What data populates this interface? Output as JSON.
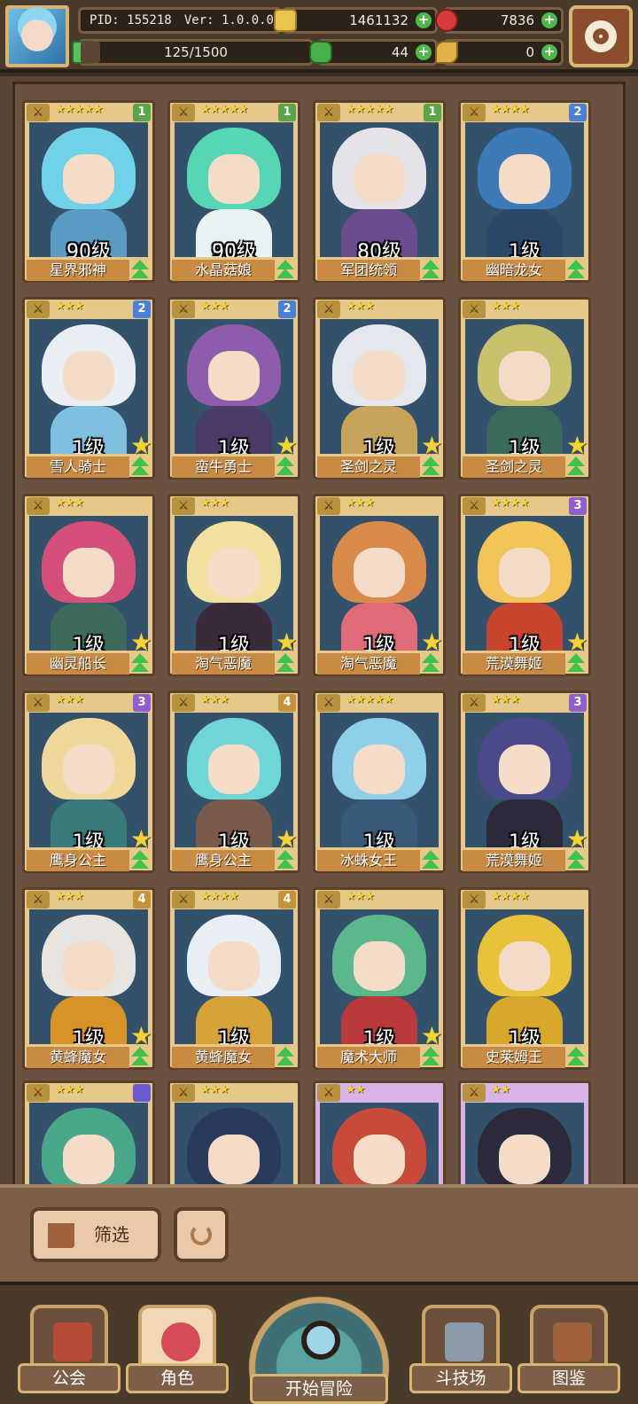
{
  "hud": {
    "pid": "PID: 155218",
    "version": "Ver: 1.0.0.0",
    "gold": "1461132",
    "gems": "7836",
    "exp_text": "125/1500",
    "exp_progress": 0.083,
    "clover": "44",
    "keys": "0",
    "plus": "+"
  },
  "icons": {
    "avatar": "player-avatar",
    "gold": "gold-coin-icon",
    "gem": "red-gem-icon",
    "clover": "clover-icon",
    "key": "key-icon",
    "settings": "gear-icon"
  },
  "cards": [
    {
      "name": "星界邪神",
      "level": "90级",
      "stars": "★★★★★",
      "badge": "1",
      "badge_color": "#5aa54a",
      "frame": "gold",
      "hair": "#6fd2e6",
      "body": "#5a9bc4",
      "has_big_star": false
    },
    {
      "name": "水晶菇娘",
      "level": "90级",
      "stars": "★★★★★",
      "badge": "1",
      "badge_color": "#5aa54a",
      "frame": "gold",
      "hair": "#57d6b6",
      "body": "#e8f2f2",
      "has_big_star": false
    },
    {
      "name": "军团统领",
      "level": "80级",
      "stars": "★★★★★",
      "badge": "1",
      "badge_color": "#5aa54a",
      "frame": "gold",
      "hair": "#e6e2ea",
      "body": "#6c4c8c",
      "has_big_star": false
    },
    {
      "name": "幽暗龙女",
      "level": "1级",
      "stars": "★★★★",
      "badge": "2",
      "badge_color": "#4a7fd6",
      "frame": "gold",
      "hair": "#3d7ab8",
      "body": "#2b4868",
      "has_big_star": false
    },
    {
      "name": "雪人骑士",
      "level": "1级",
      "stars": "★★★",
      "badge": "2",
      "badge_color": "#4a7fd6",
      "frame": "gold",
      "hair": "#e8eef4",
      "body": "#7fbfe0",
      "has_big_star": true
    },
    {
      "name": "蛮牛勇士",
      "level": "1级",
      "stars": "★★★",
      "badge": "2",
      "badge_color": "#4a7fd6",
      "frame": "gold",
      "hair": "#8e5cab",
      "body": "#4b3a68",
      "has_big_star": true
    },
    {
      "name": "圣剑之灵",
      "level": "1级",
      "stars": "★★★",
      "badge": "",
      "badge_color": "",
      "frame": "gold",
      "hair": "#e4e8ee",
      "body": "#c8a35a",
      "has_big_star": true
    },
    {
      "name": "圣剑之灵",
      "level": "1级",
      "stars": "★★★",
      "badge": "",
      "badge_color": "",
      "frame": "gold",
      "hair": "#c9c26c",
      "body": "#3a6a5a",
      "has_big_star": true
    },
    {
      "name": "幽灵船长",
      "level": "1级",
      "stars": "★★★",
      "badge": "",
      "badge_color": "",
      "frame": "gold",
      "hair": "#d44f7a",
      "body": "#3c6a5c",
      "has_big_star": true
    },
    {
      "name": "淘气恶魔",
      "level": "1级",
      "stars": "★★★",
      "badge": "",
      "badge_color": "",
      "frame": "gold",
      "hair": "#f2e0a0",
      "body": "#3a2a3a",
      "has_big_star": true
    },
    {
      "name": "淘气恶魔",
      "level": "1级",
      "stars": "★★★",
      "badge": "",
      "badge_color": "",
      "frame": "gold",
      "hair": "#d88a4a",
      "body": "#e06a78",
      "has_big_star": true
    },
    {
      "name": "荒漠舞姬",
      "level": "1级",
      "stars": "★★★★",
      "badge": "3",
      "badge_color": "#8f5fd0",
      "frame": "gold",
      "hair": "#f2c45a",
      "body": "#c8442c",
      "has_big_star": true
    },
    {
      "name": "鹰身公主",
      "level": "1级",
      "stars": "★★★",
      "badge": "3",
      "badge_color": "#8f5fd0",
      "frame": "gold",
      "hair": "#f0d89a",
      "body": "#3a7a7a",
      "has_big_star": true
    },
    {
      "name": "鹰身公主",
      "level": "1级",
      "stars": "★★★",
      "badge": "4",
      "badge_color": "#c4943a",
      "frame": "gold",
      "hair": "#6fd6d8",
      "body": "#7a5a4a",
      "has_big_star": true
    },
    {
      "name": "冰蛛女王",
      "level": "1级",
      "stars": "★★★★★",
      "badge": "",
      "badge_color": "",
      "frame": "gold",
      "hair": "#8fd0e8",
      "body": "#3a5a7a",
      "has_big_star": false
    },
    {
      "name": "荒漠舞姬",
      "level": "1级",
      "stars": "★★★",
      "badge": "3",
      "badge_color": "#8f5fd0",
      "frame": "gold",
      "hair": "#4a4a8a",
      "body": "#2a2a3a",
      "has_big_star": true
    },
    {
      "name": "黄蜂魔女",
      "level": "1级",
      "stars": "★★★",
      "badge": "4",
      "badge_color": "#c4943a",
      "frame": "gold",
      "hair": "#e8e4e0",
      "body": "#d8922a",
      "has_big_star": true
    },
    {
      "name": "黄蜂魔女",
      "level": "1级",
      "stars": "★★★★",
      "badge": "4",
      "badge_color": "#c4943a",
      "frame": "gold",
      "hair": "#e8eef4",
      "body": "#d8a23a",
      "has_big_star": false
    },
    {
      "name": "魔术大师",
      "level": "1级",
      "stars": "★★★",
      "badge": "",
      "badge_color": "",
      "frame": "gold",
      "hair": "#5ab88a",
      "body": "#b83a3a",
      "has_big_star": true
    },
    {
      "name": "史莱姆王",
      "level": "1级",
      "stars": "★★★★",
      "badge": "",
      "badge_color": "",
      "frame": "gold",
      "hair": "#e8c23a",
      "body": "#d8a82a",
      "has_big_star": false
    },
    {
      "name": "",
      "level": "",
      "stars": "★★★",
      "badge": "",
      "badge_color": "#6a5ad0",
      "frame": "gold",
      "hair": "#4aa88a",
      "body": "#2a5a4a",
      "has_big_star": false
    },
    {
      "name": "",
      "level": "",
      "stars": "★★★",
      "badge": "",
      "badge_color": "",
      "frame": "gold",
      "hair": "#2a3a5a",
      "body": "#7a4a2a",
      "has_big_star": false
    },
    {
      "name": "",
      "level": "",
      "stars": "★★",
      "badge": "",
      "badge_color": "",
      "frame": "purple",
      "hair": "#c84a3a",
      "body": "#3a2a2a",
      "has_big_star": false
    },
    {
      "name": "",
      "level": "",
      "stars": "★★",
      "badge": "",
      "badge_color": "",
      "frame": "purple",
      "hair": "#2a2a3a",
      "body": "#e8e8ee",
      "has_big_star": false
    }
  ],
  "controls": {
    "filter_label": "筛选"
  },
  "nav": {
    "guild": "公会",
    "character": "角色",
    "adventure": "开始冒险",
    "arena": "斗技场",
    "codex": "图鉴"
  }
}
